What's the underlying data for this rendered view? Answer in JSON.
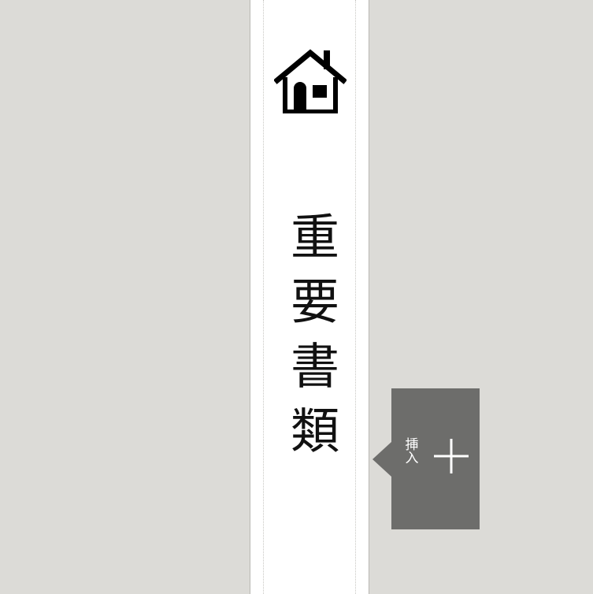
{
  "canvas": {
    "background_color": "#dcdbd7"
  },
  "label_strip": {
    "icon": "home-icon",
    "title": "重要書類",
    "background_color": "#ffffff",
    "text_color": "#111111"
  },
  "insert_tab": {
    "label": "挿入",
    "icon": "plus-icon",
    "background_color": "#6d6d6b",
    "text_color": "#ffffff"
  }
}
